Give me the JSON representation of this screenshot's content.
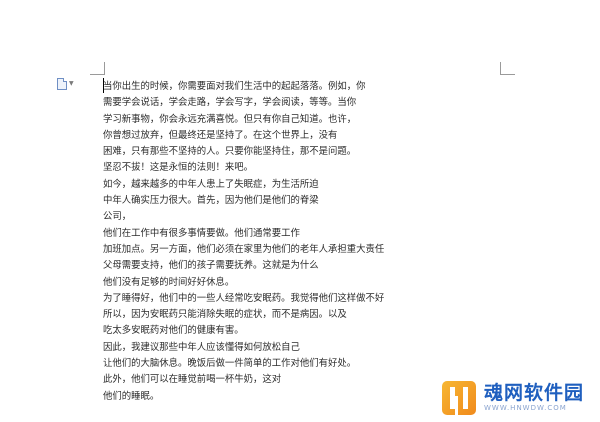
{
  "document": {
    "lines": [
      "当你出生的时候，你需要面对我们生活中的起起落落。例如，你",
      "需要学会说话，学会走路，学会写字，学会阅读，等等。当你",
      "学习新事物，你会永远充满喜悦。但只有你自己知道。也许，",
      "你曾想过放弃，但最终还是坚持了。在这个世界上，没有",
      "困难，只有那些不坚持的人。只要你能坚持住，那不是问题。",
      "坚忍不拔！这是永恒的法则！来吧。",
      "如今，越来越多的中年人患上了失眠症，为生活所迫",
      "中年人确实压力很大。首先，因为他们是他们的脊梁",
      "公司，",
      "他们在工作中有很多事情要做。他们通常要工作",
      "加班加点。另一方面，他们必须在家里为他们的老年人承担重大责任",
      "父母需要支持，他们的孩子需要抚养。这就是为什么",
      "他们没有足够的时间好好休息。",
      "为了睡得好，他们中的一些人经常吃安眠药。我觉得他们这样做不好",
      "所以，因为安眠药只能消除失眠的症状，而不是病因。以及",
      "吃太多安眠药对他们的健康有害。",
      "因此，我建议那些中年人应该懂得如何放松自己",
      "让他们的大脑休息。晚饭后做一件简单的工作对他们有好处。",
      "此外，他们可以在睡觉前喝一杯牛奶，这对",
      "他们的睡眠。"
    ]
  },
  "icons": {
    "paragraph_marker": "document-icon",
    "paragraph_caret": "caret-down-icon"
  },
  "watermark": {
    "title": "魂网软件园",
    "subtitle": "WWW.HNWDW.COM",
    "logo_colors": [
      "#f7b733",
      "#f08a1c"
    ],
    "title_color": "#1f5fbf"
  }
}
